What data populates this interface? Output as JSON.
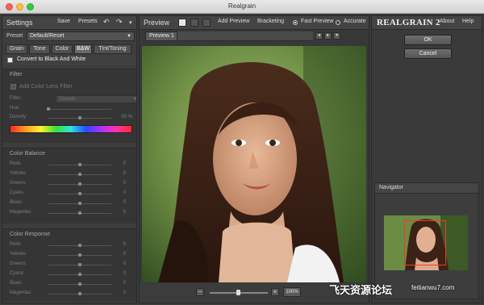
{
  "app": {
    "title": "Realgrain"
  },
  "settings": {
    "title": "Settings",
    "save_label": "Save",
    "presets_label": "Presets",
    "preset_label": "Preset",
    "preset_value": "Default/Reset",
    "tabs": [
      "Grain",
      "Tone",
      "Color",
      "B&W",
      "Tint/Toning"
    ],
    "active_tab": "B&W",
    "convert_bw_label": "Convert to Black And White",
    "filter": {
      "title": "Filter",
      "add_lens_label": "Add Color Lens Filter",
      "filter_label": "Filter:",
      "filter_value": "Custom",
      "hue_label": "Hue:",
      "density_label": "Density:",
      "density_value": "50 %"
    },
    "color_balance": {
      "title": "Color Balance",
      "rows": [
        {
          "label": "Reds",
          "value": "0"
        },
        {
          "label": "Yellows",
          "value": "0"
        },
        {
          "label": "Greens",
          "value": "0"
        },
        {
          "label": "Cyans",
          "value": "0"
        },
        {
          "label": "Blues",
          "value": "0"
        },
        {
          "label": "Magentas",
          "value": "0"
        }
      ]
    },
    "color_response": {
      "title": "Color Response",
      "rows": [
        {
          "label": "Reds",
          "value": "0"
        },
        {
          "label": "Yellows",
          "value": "0"
        },
        {
          "label": "Greens",
          "value": "0"
        },
        {
          "label": "Cyans",
          "value": "0"
        },
        {
          "label": "Blues",
          "value": "0"
        },
        {
          "label": "Magentas",
          "value": "0"
        }
      ]
    }
  },
  "preview": {
    "title": "Preview",
    "add_preview_label": "Add Preview",
    "bracketing_label": "Bracketing",
    "fast_preview_label": "Fast Preview",
    "accurate_label": "Accurate",
    "mode": "Fast Preview",
    "tab_label": "Preview 1",
    "zoom_value": "100%"
  },
  "right": {
    "logo": "REALGRAIN 2",
    "about_label": "About",
    "help_label": "Help",
    "ok_label": "OK",
    "cancel_label": "Cancel",
    "navigator_title": "Navigator"
  },
  "watermark": {
    "cn": "飞天资源论坛",
    "url": "feitianwu7.com"
  },
  "colors": {
    "panel": "#3d3d3d",
    "header": "#444444",
    "accent": "#ffffff",
    "nav_rect": "#ff3030"
  }
}
